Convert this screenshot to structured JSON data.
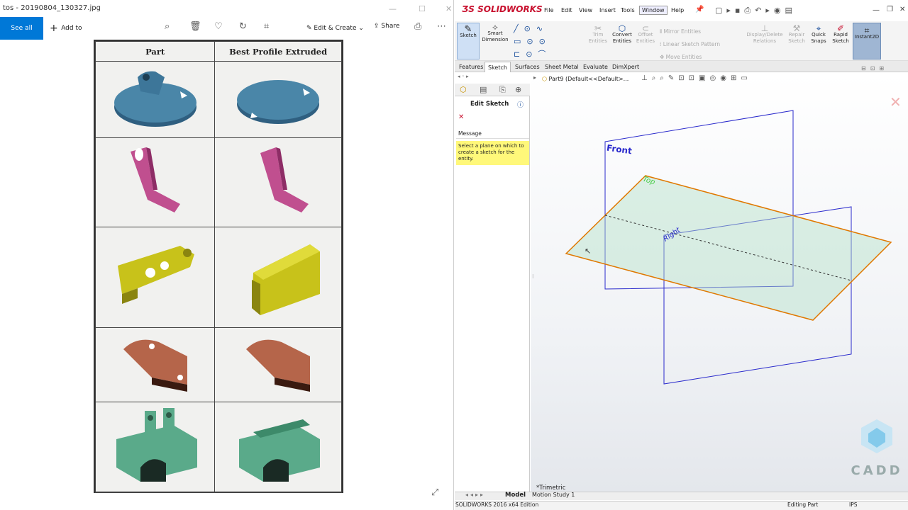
{
  "photos": {
    "title": "tos - 20190804_130327.jpg",
    "toolbar": {
      "see_all": "See all photos",
      "add_to": "Add to",
      "edit_create": "Edit & Create",
      "share": "Share"
    },
    "table": {
      "col_part": "Part",
      "col_profile": "Best Profile Extruded"
    }
  },
  "solidworks": {
    "logo": "SOLIDWORKS",
    "menu": [
      "File",
      "Edit",
      "View",
      "Insert",
      "Tools",
      "Window",
      "Help"
    ],
    "commands": {
      "sketch": "Sketch",
      "smart_dimension": "Smart Dimension",
      "trim": "Trim Entities",
      "convert": "Convert Entities",
      "offset": "Offset Entities",
      "mirror": "Mirror Entities",
      "linear_pattern": "Linear Sketch Pattern",
      "move": "Move Entities",
      "display_delete": "Display/Delete Relations",
      "repair": "Repair Sketch",
      "quick_snaps": "Quick Snaps",
      "rapid_sketch": "Rapid Sketch",
      "instant2d": "Instant2D"
    },
    "tabs": [
      "Features",
      "Sketch",
      "Surfaces",
      "Sheet Metal",
      "Evaluate",
      "DimXpert"
    ],
    "active_tab": "Sketch",
    "property_manager": {
      "title": "Edit Sketch",
      "message_header": "Message",
      "message": "Select a plane on which to create a sketch for the entity."
    },
    "tree": "Part9  (Default<<Default>...",
    "planes": {
      "front": "Front",
      "top": "Top",
      "right": "Right"
    },
    "view_name": "*Trimetric",
    "bottom_tabs": [
      "Model",
      "Motion Study 1"
    ],
    "status": {
      "edition": "SOLIDWORKS 2016 x64 Edition",
      "mode": "Editing Part",
      "units": "IPS"
    },
    "watermark": "CADD"
  }
}
